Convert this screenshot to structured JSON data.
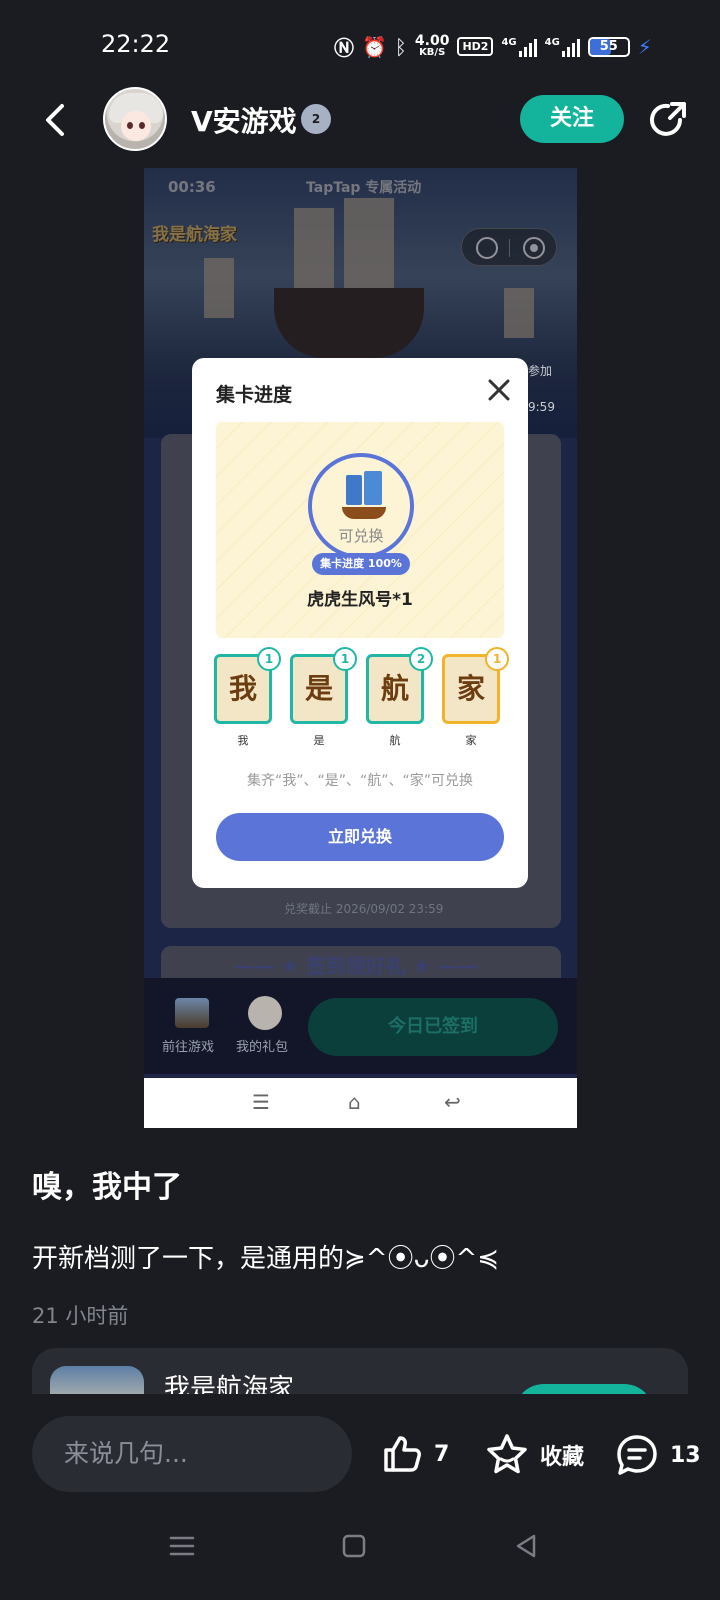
{
  "status_bar": {
    "time": "22:22",
    "net_speed_value": "4.00",
    "net_speed_unit": "KB/S",
    "hd_label": "HD2",
    "sig1_label": "4G",
    "sig2_label": "4G",
    "battery": "55",
    "battery_level": 0.55
  },
  "header": {
    "username": "V安游戏",
    "level": "2",
    "follow_label": "关注"
  },
  "screenshot": {
    "status_time": "00:36",
    "status_title": "TapTap 专属活动",
    "game_logo": "我是航海家",
    "side_text_1": "参加",
    "side_text_2": "9:59",
    "exchange_deadline": "兑奖截止 2026/09/02 23:59",
    "checkin_banner": "—— ★ 签到领好礼 ★ ——",
    "goto_game_label": "前往游戏",
    "my_gift_label": "我的礼包",
    "checkin_button": "今日已签到"
  },
  "modal": {
    "title": "集卡进度",
    "redeemable_text": "可兑换",
    "progress_label": "集卡进度 100%",
    "progress": 1.0,
    "reward_name": "虎虎生风号*1",
    "cards": [
      {
        "char": "我",
        "count": "1",
        "label": "我"
      },
      {
        "char": "是",
        "count": "1",
        "label": "是"
      },
      {
        "char": "航",
        "count": "2",
        "label": "航"
      },
      {
        "char": "家",
        "count": "1",
        "label": "家"
      }
    ],
    "hint": "集齐“我”、“是”、“航”、“家”可兑换",
    "redeem_label": "立即兑换"
  },
  "post": {
    "title": "嗅，我中了",
    "body": "开新档测了一下，是通用的≽^⦿ᴗ⦿^≼",
    "time": "21 小时前"
  },
  "game_card": {
    "name": "我是航海家"
  },
  "actions": {
    "comment_placeholder": "来说几句...",
    "like_count": "7",
    "favorite_label": "收藏",
    "comment_count": "13"
  },
  "colors": {
    "accent": "#14b39c",
    "modal_blue": "#5b74d8",
    "background": "#1b1c21"
  }
}
